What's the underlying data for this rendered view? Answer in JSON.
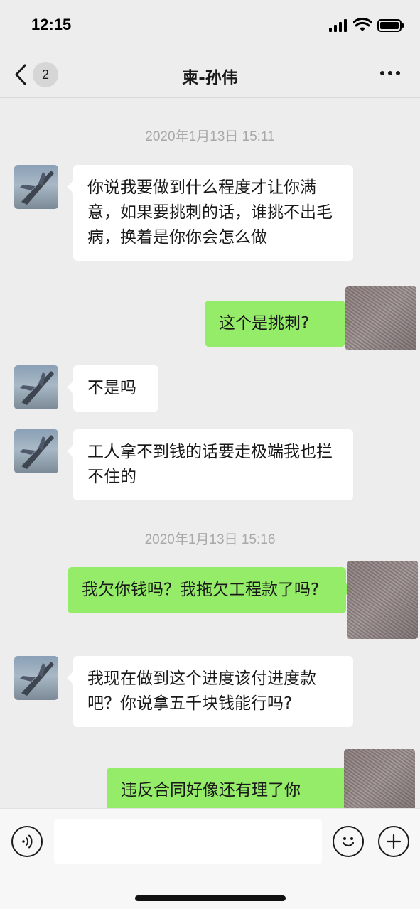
{
  "status_bar": {
    "time": "12:15"
  },
  "nav": {
    "unread_count": "2",
    "title": "柬-孙伟"
  },
  "messages": [
    {
      "type": "timestamp",
      "text": "2020年1月13日 15:11"
    },
    {
      "type": "incoming",
      "text": "你说我要做到什么程度才让你满意，如果要挑刺的话，谁挑不出毛病，换着是你你会怎么做"
    },
    {
      "type": "outgoing",
      "text": "这个是挑刺?"
    },
    {
      "type": "incoming",
      "text": "不是吗"
    },
    {
      "type": "incoming",
      "text": "工人拿不到钱的话要走极端我也拦不住的"
    },
    {
      "type": "timestamp",
      "text": "2020年1月13日 15:16"
    },
    {
      "type": "outgoing",
      "text": "我欠你钱吗？我拖欠工程款了吗?"
    },
    {
      "type": "incoming",
      "text": "我现在做到这个进度该付进度款吧？你说拿五千块钱能行吗?"
    },
    {
      "type": "outgoing",
      "text": "违反合同好像还有理了你"
    }
  ],
  "colors": {
    "outgoing_bubble": "#95ec69",
    "incoming_bubble": "#ffffff",
    "background": "#ededed"
  },
  "icons": {
    "back": "chevron-left-icon",
    "more": "more-dots-icon",
    "voice": "voice-icon",
    "emoji": "emoji-icon",
    "add": "plus-icon"
  }
}
